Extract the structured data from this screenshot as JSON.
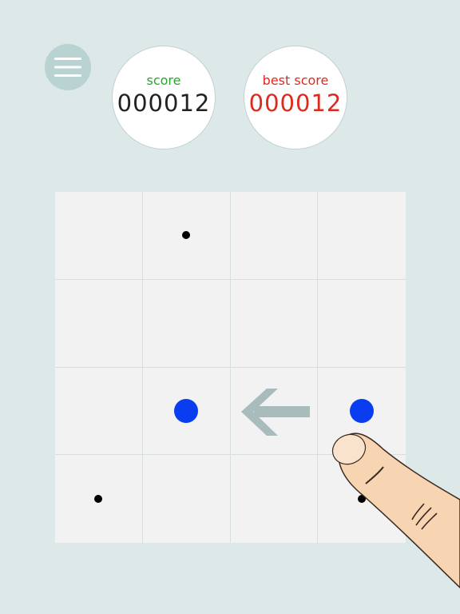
{
  "colors": {
    "background": "#dde8e8",
    "score_label": "#2aa52a",
    "best_label": "#e0291e",
    "score_value": "#222222",
    "best_value": "#e0291e",
    "big_dot": "#0a3cf0",
    "arrow": "#a8bcbc"
  },
  "menu": {
    "icon": "hamburger-icon"
  },
  "score": {
    "label": "score",
    "value": "000012"
  },
  "best": {
    "label": "best score",
    "value": "000012"
  },
  "board": {
    "rows": 4,
    "cols": 4,
    "cells": [
      [
        "empty",
        "small",
        "empty",
        "empty"
      ],
      [
        "empty",
        "empty",
        "empty",
        "empty"
      ],
      [
        "empty",
        "big",
        "empty",
        "big"
      ],
      [
        "small",
        "empty",
        "empty",
        "small"
      ]
    ]
  },
  "hint": {
    "arrow_direction": "left",
    "icon": "finger-swipe-icon"
  }
}
